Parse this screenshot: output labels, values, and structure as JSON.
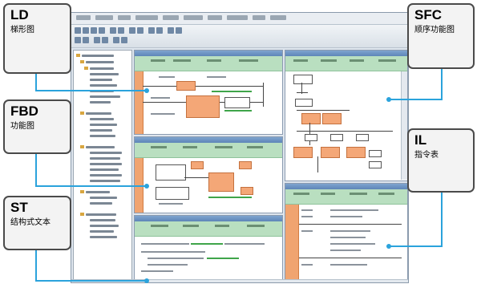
{
  "callouts": {
    "ld": {
      "name": "LD",
      "desc": "梯形图"
    },
    "fbd": {
      "name": "FBD",
      "desc": "功能图"
    },
    "st": {
      "name": "ST",
      "desc": "结构式文本"
    },
    "sfc": {
      "name": "SFC",
      "desc": "顺序功能图"
    },
    "il": {
      "name": "IL",
      "desc": "指令表"
    }
  },
  "colors": {
    "connector": "#2ba3dc",
    "callout_border": "#4a4a4a",
    "callout_fill": "#f3f3f3",
    "block_fill": "#f4a777",
    "header_fill": "#b9dfc0"
  }
}
